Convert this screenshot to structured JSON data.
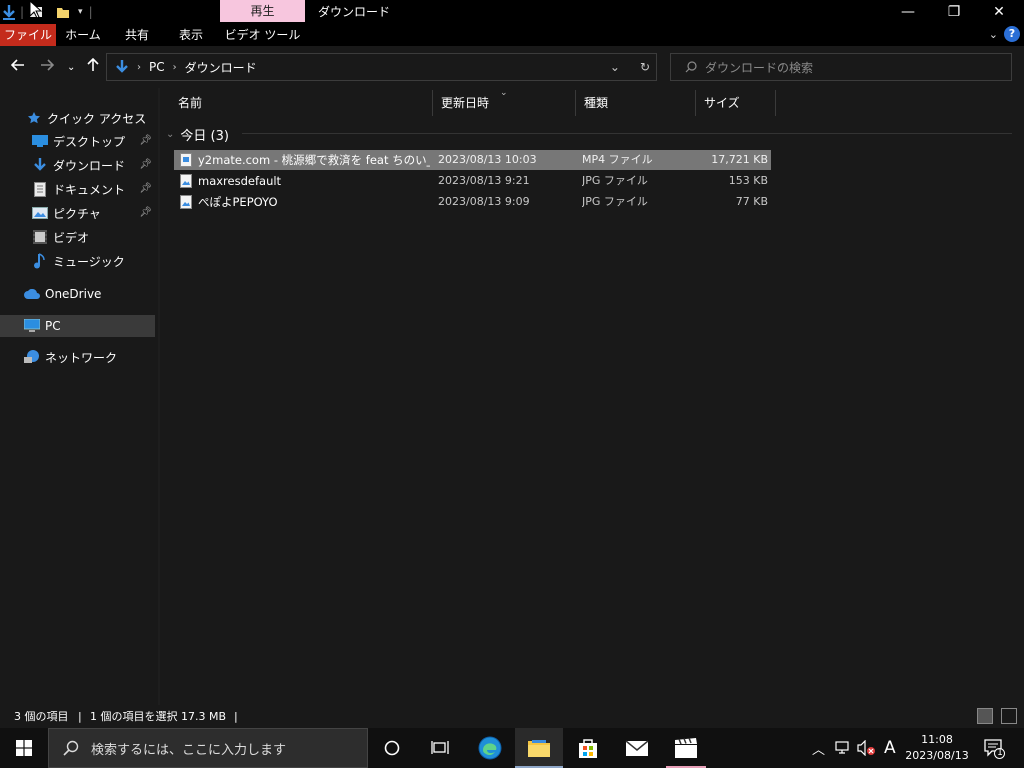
{
  "title_bar": {
    "context_tab": "再生",
    "window_title": "ダウンロード",
    "minimize": "—",
    "maximize": "❐",
    "close": "✕"
  },
  "ribbon": {
    "tabs": [
      "ファイル",
      "ホーム",
      "共有",
      "表示",
      "ビデオ ツール"
    ],
    "help": "?"
  },
  "address_bar": {
    "crumbs": [
      "PC",
      "ダウンロード"
    ],
    "search_placeholder": "ダウンロードの検索"
  },
  "nav_pane": {
    "quick_access": "クイック アクセス",
    "quick_items": [
      {
        "label": "デスクトップ",
        "icon": "desktop-icon"
      },
      {
        "label": "ダウンロード",
        "icon": "download-icon"
      },
      {
        "label": "ドキュメント",
        "icon": "document-icon"
      },
      {
        "label": "ピクチャ",
        "icon": "pictures-icon"
      },
      {
        "label": "ビデオ",
        "icon": "video-icon"
      },
      {
        "label": "ミュージック",
        "icon": "music-icon"
      }
    ],
    "onedrive": "OneDrive",
    "pc": "PC",
    "network": "ネットワーク"
  },
  "columns": {
    "name": "名前",
    "date": "更新日時",
    "type": "種類",
    "size": "サイズ"
  },
  "group": {
    "label": "今日 (3)"
  },
  "files": [
    {
      "name": "y2mate.com - 桃源郷で救済を feat ちのい_...",
      "date": "2023/08/13 10:03",
      "type": "MP4 ファイル",
      "size": "17,721 KB",
      "selected": true
    },
    {
      "name": "maxresdefault",
      "date": "2023/08/13 9:21",
      "type": "JPG ファイル",
      "size": "153 KB",
      "selected": false
    },
    {
      "name": "ぺぽよPEPOYO",
      "date": "2023/08/13 9:09",
      "type": "JPG ファイル",
      "size": "77 KB",
      "selected": false
    }
  ],
  "status_bar": {
    "item_count": "3 個の項目",
    "selection": "1 個の項目を選択  17.3 MB"
  },
  "taskbar": {
    "search_placeholder": "検索するには、ここに入力します",
    "time": "11:08",
    "date": "2023/08/13",
    "ime": "A",
    "notification_count": "1"
  },
  "colors": {
    "ribbon_file_tab": "#c42b1c",
    "context_tab": "#f7c6de",
    "selection": "#777777",
    "pane_bg": "#191919"
  }
}
